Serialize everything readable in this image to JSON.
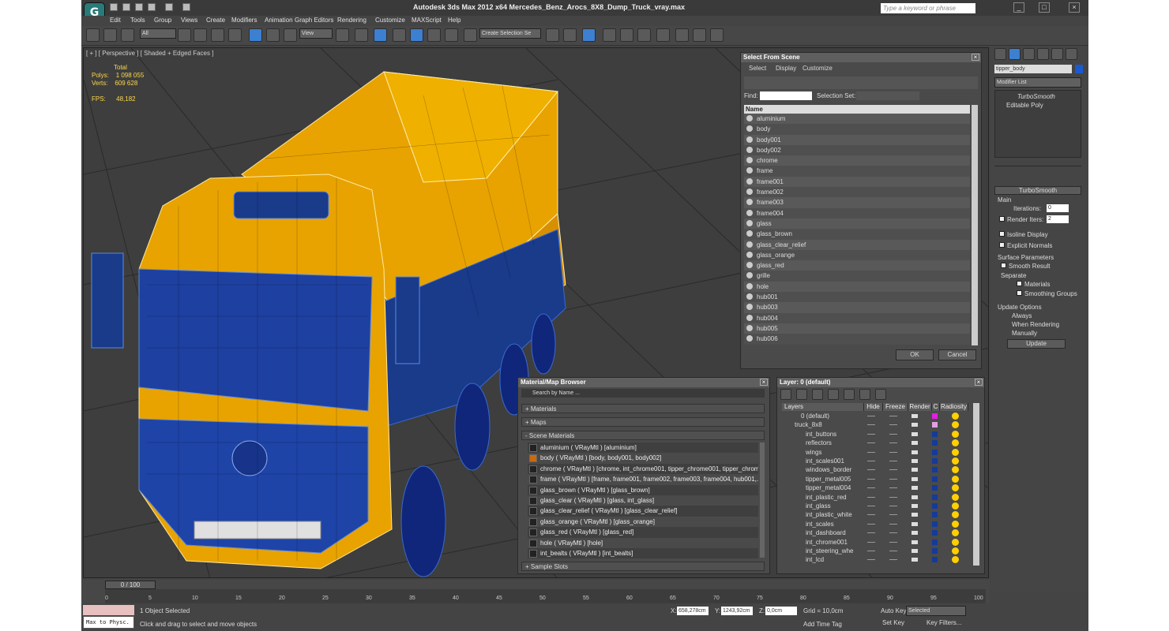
{
  "window": {
    "title": "Autodesk 3ds Max  2012 x64     Mercedes_Benz_Arocs_8X8_Dump_Truck_vray.max",
    "search_placeholder": "Type a keyword or phrase"
  },
  "menus": [
    "Edit",
    "Tools",
    "Group",
    "Views",
    "Create",
    "Modifiers",
    "Animation",
    "Graph Editors",
    "Rendering",
    "Customize",
    "MAXScript",
    "Help"
  ],
  "toolbar": {
    "selection_filter": "All",
    "ref_coord": "View",
    "named_selection": "Create Selection Se"
  },
  "viewport": {
    "label": "[ + ] [ Perspective ] [ Shaded + Edged Faces ]",
    "stats_total": "Total",
    "polys_label": "Polys:",
    "polys": "1 098 055",
    "verts_label": "Verts:",
    "verts": "609 628",
    "fps_label": "FPS:",
    "fps": "48,182"
  },
  "select_from_scene": {
    "title": "Select From Scene",
    "tabs": [
      "Select",
      "Display",
      "Customize"
    ],
    "find_label": "Find:",
    "selection_set_label": "Selection Set:",
    "column": "Name",
    "items": [
      "aluminium",
      "body",
      "body001",
      "body002",
      "chrome",
      "frame",
      "frame001",
      "frame002",
      "frame003",
      "frame004",
      "glass",
      "glass_brown",
      "glass_clear_relief",
      "glass_orange",
      "glass_red",
      "grille",
      "hole",
      "hub001",
      "hub003",
      "hub004",
      "hub005",
      "hub006"
    ],
    "ok": "OK",
    "cancel": "Cancel"
  },
  "material_browser": {
    "title": "Material/Map Browser",
    "search_placeholder": "Search by Name ...",
    "sections": [
      "+ Materials",
      "+ Maps",
      "- Scene Materials",
      "+ Sample Slots"
    ],
    "materials": [
      "aluminium  ( VRayMtl ) [aluminium]",
      "body  ( VRayMtl ) [body, body001, body002]",
      "chrome  ( VRayMtl ) [chrome, int_chrome001, tipper_chrome001, tipper_chrome...",
      "frame  ( VRayMtl ) [frame, frame001, frame002, frame003, frame004, hub001,...",
      "glass_brown  ( VRayMtl ) [glass_brown]",
      "glass_clear  ( VRayMtl ) [glass, int_glass]",
      "glass_clear_relief  ( VRayMtl ) [glass_clear_relief]",
      "glass_orange  ( VRayMtl ) [glass_orange]",
      "glass_red  ( VRayMtl ) [glass_red]",
      "hole  ( VRayMtl ) [hole]",
      "int_bealts  ( VRayMtl ) [int_bealts]"
    ]
  },
  "layers": {
    "title": "Layer: 0 (default)",
    "columns": [
      "Layers",
      "Hide",
      "Freeze",
      "Render",
      "C",
      "Radiosity"
    ],
    "rows": [
      "0 (default)",
      "truck_8x8",
      "int_buttons",
      "reflectors",
      "wings",
      "int_scales001",
      "windows_border",
      "tipper_metal005",
      "tipper_metal004",
      "int_plastic_red",
      "int_glass",
      "int_plastic_white",
      "int_scales",
      "int_dashboard",
      "int_chrome001",
      "int_steering_whe",
      "int_lcd"
    ]
  },
  "command_panel": {
    "object_name": "tipper_body",
    "modifier_list": "Modifier List",
    "stack": [
      "TurboSmooth",
      "Editable Poly"
    ],
    "rollout_title": "TurboSmooth",
    "main_label": "Main",
    "iterations_label": "Iterations:",
    "iterations": "0",
    "render_iters_label": "Render Iters:",
    "render_iters": "2",
    "isoline": "Isoline Display",
    "explicit": "Explicit Normals",
    "surface_params": "Surface Parameters",
    "smooth_result": "Smooth Result",
    "separate": "Separate",
    "materials": "Materials",
    "smoothing_groups": "Smoothing Groups",
    "update_options": "Update Options",
    "always": "Always",
    "when_rendering": "When Rendering",
    "manually": "Manually",
    "update": "Update"
  },
  "timeline": {
    "slider": "0 / 100",
    "ticks": [
      "0",
      "5",
      "10",
      "15",
      "20",
      "25",
      "30",
      "35",
      "40",
      "45",
      "50",
      "55",
      "60",
      "65",
      "70",
      "75",
      "80",
      "85",
      "90",
      "95",
      "100"
    ]
  },
  "status": {
    "selected": "1 Object Selected",
    "prompt": "Click and drag to select and move objects",
    "x_label": "X:",
    "x": "658,278cm",
    "y_label": "Y:",
    "y": "1243,92cm",
    "z_label": "Z:",
    "z": "0,0cm",
    "grid": "Grid = 10,0cm",
    "add_time_tag": "Add Time Tag",
    "auto_key": "Auto Key",
    "set_key": "Set Key",
    "key_mode": "Selected",
    "key_filters": "Key Filters...",
    "maxscript": "Max to Physc."
  }
}
